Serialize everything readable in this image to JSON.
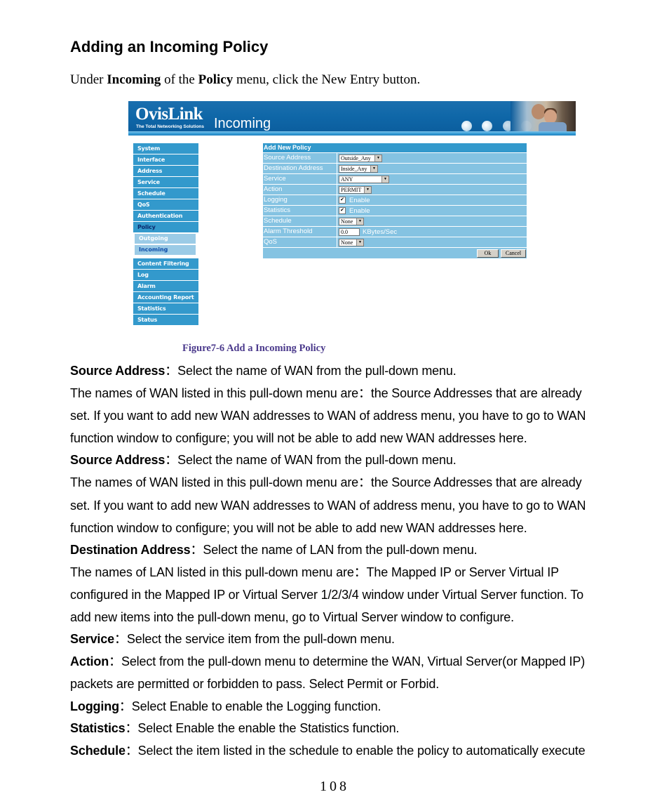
{
  "heading": "Adding an Incoming Policy",
  "intro": {
    "prefix": "Under ",
    "bold1": "Incoming",
    "mid": " of the ",
    "bold2": "Policy",
    "suffix": " menu, click the New Entry button."
  },
  "screenshot": {
    "logo": "OvisLink",
    "logo_tagline": "The Total Networking Solutions",
    "page_title": "Incoming",
    "menu": [
      {
        "label": "System"
      },
      {
        "label": "Interface"
      },
      {
        "label": "Address"
      },
      {
        "label": "Service"
      },
      {
        "label": "Schedule"
      },
      {
        "label": "QoS"
      },
      {
        "label": "Authentication"
      },
      {
        "label": "Policy"
      }
    ],
    "submenu": [
      {
        "label": "Outgoing"
      },
      {
        "label": "Incoming"
      }
    ],
    "menu2": [
      {
        "label": "Content Filtering"
      },
      {
        "label": "Log"
      },
      {
        "label": "Alarm"
      },
      {
        "label": "Accounting Report"
      },
      {
        "label": "Statistics"
      },
      {
        "label": "Status"
      }
    ],
    "form": {
      "title": "Add New Policy",
      "source_address": {
        "label": "Source Address",
        "value": "Outside_Any"
      },
      "destination_address": {
        "label": "Destination Address",
        "value": "Inside_Any"
      },
      "service": {
        "label": "Service",
        "value": "ANY"
      },
      "action": {
        "label": "Action",
        "value": "PERMIT"
      },
      "logging": {
        "label": "Logging",
        "checked": true,
        "option": "Enable"
      },
      "statistics": {
        "label": "Statistics",
        "checked": true,
        "option": "Enable"
      },
      "schedule": {
        "label": "Schedule",
        "value": "None"
      },
      "alarm_threshold": {
        "label": "Alarm Threshold",
        "value": "0.0",
        "unit": "KBytes/Sec"
      },
      "qos": {
        "label": "QoS",
        "value": "None"
      },
      "ok_label": "Ok",
      "cancel_label": "Cancel"
    }
  },
  "caption": "Figure7-6 Add a Incoming Policy",
  "paragraphs": [
    {
      "bold": "Source Address",
      "text": "：Select the name of WAN from the pull-down menu."
    },
    {
      "bold": "",
      "text": "The names of WAN listed in this pull-down menu are：the Source Addresses that are already"
    },
    {
      "bold": "",
      "text": "set. If you want to add new WAN addresses to WAN of address menu, you have to go to WAN"
    },
    {
      "bold": "",
      "text": "function window to configure; you will not be able to add new WAN addresses here."
    },
    {
      "bold": "Source Address",
      "text": "：Select the name of WAN from the pull-down menu."
    },
    {
      "bold": "",
      "text": "The names of WAN listed in this pull-down menu are：the Source Addresses that are already"
    },
    {
      "bold": "",
      "text": "set. If you want to add new WAN addresses to WAN of address menu, you have to go to WAN"
    },
    {
      "bold": "",
      "text": "function window to configure; you will not be able to add new WAN addresses here."
    },
    {
      "bold": "Destination Address",
      "text": "：Select the name of LAN from the pull-down menu."
    },
    {
      "bold": "",
      "text": "The names of LAN listed in this pull-down menu are：The Mapped IP or Server Virtual IP"
    },
    {
      "bold": "",
      "text": "configured in the Mapped IP or Virtual Server 1/2/3/4 window under Virtual Server function. To"
    },
    {
      "bold": "",
      "text": "add new items into the pull-down menu, go to Virtual Server window to configure."
    },
    {
      "bold": "Service",
      "text": "：Select the service item from the pull-down menu."
    },
    {
      "bold": "Action",
      "text": "：Select from the pull-down menu to determine the WAN, Virtual Server(or Mapped IP)"
    },
    {
      "bold": "",
      "text": "packets are permitted or forbidden to pass. Select Permit or Forbid."
    },
    {
      "bold": "Logging",
      "text": "：Select Enable to enable the Logging function."
    },
    {
      "bold": "Statistics",
      "text": "：Select Enable the enable the Statistics function."
    },
    {
      "bold": "Schedule",
      "text": "：Select the item listed in the schedule to enable the policy to automatically execute"
    }
  ],
  "page_number": "108"
}
